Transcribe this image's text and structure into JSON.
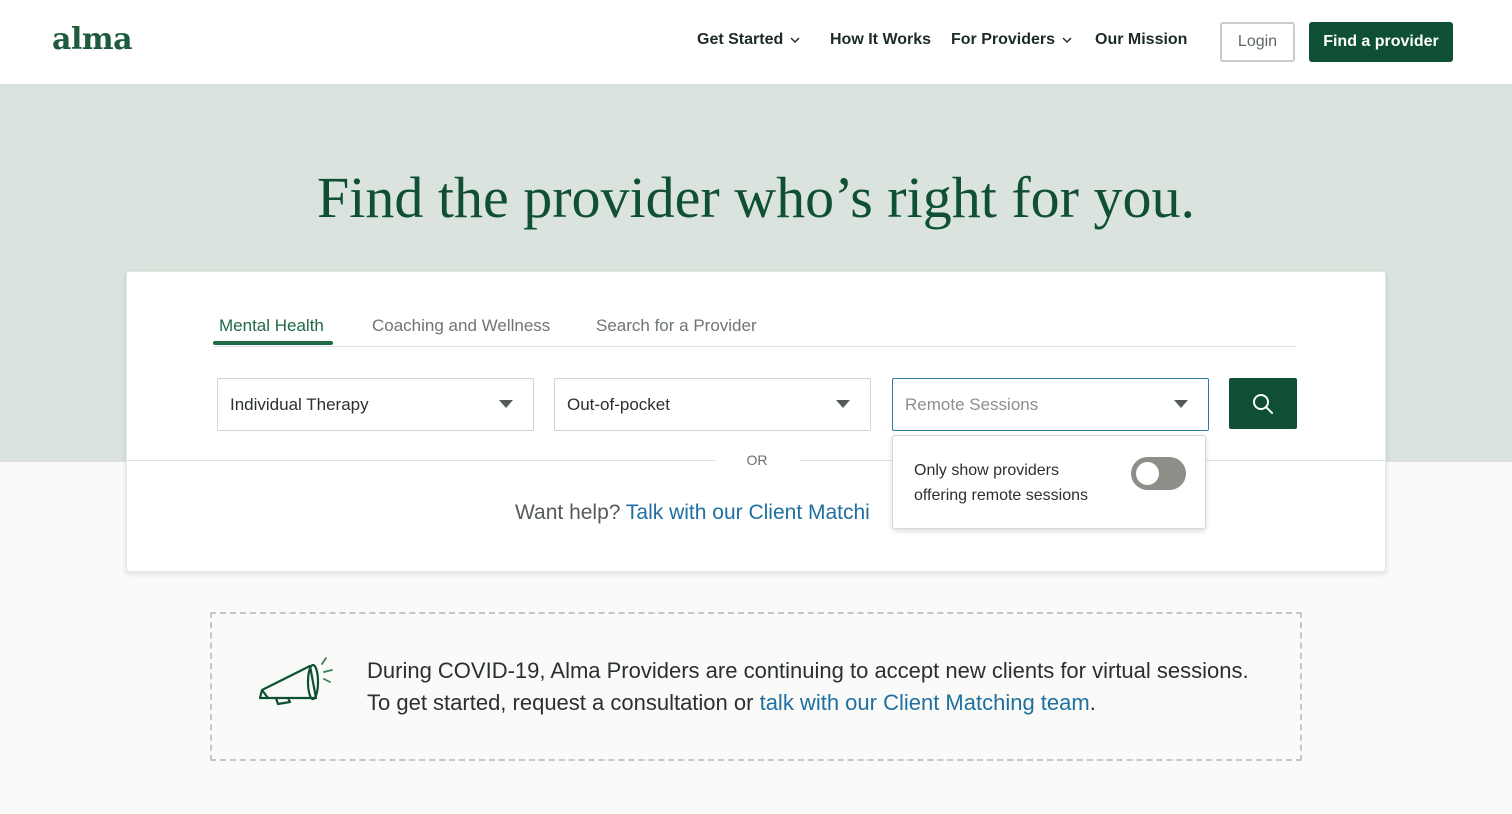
{
  "header": {
    "logo": "alma",
    "nav": [
      {
        "label": "Get Started",
        "has_dropdown": true
      },
      {
        "label": "How It Works",
        "has_dropdown": false
      },
      {
        "label": "For Providers",
        "has_dropdown": true
      },
      {
        "label": "Our Mission",
        "has_dropdown": false
      }
    ],
    "login_label": "Login",
    "find_provider_label": "Find a provider"
  },
  "hero": {
    "title": "Find the provider who’s right for you."
  },
  "search": {
    "tabs": [
      {
        "label": "Mental Health",
        "active": true
      },
      {
        "label": "Coaching and Wellness",
        "active": false
      },
      {
        "label": "Search for a Provider",
        "active": false
      }
    ],
    "session_type": "Individual Therapy",
    "payment": "Out-of-pocket",
    "remote_placeholder": "Remote Sessions",
    "search_icon": "search-icon",
    "or_label": "OR",
    "help_prefix": "Want help?",
    "help_link": "Talk with our Client Matchi"
  },
  "remote_popover": {
    "line1": "Only show providers",
    "line2": "offering remote sessions",
    "toggle_on": false
  },
  "notice": {
    "icon": "megaphone-icon",
    "line1": "During COVID-19, Alma Providers are continuing to accept new clients for virtual sessions.",
    "line2_prefix": "To get started, request a consultation or",
    "line2_link": "talk with our Client Matching team",
    "line2_suffix": "."
  },
  "colors": {
    "brand_green": "#0e4f35",
    "hero_bg": "#dbe3de",
    "link_blue": "#1f6fa0"
  }
}
